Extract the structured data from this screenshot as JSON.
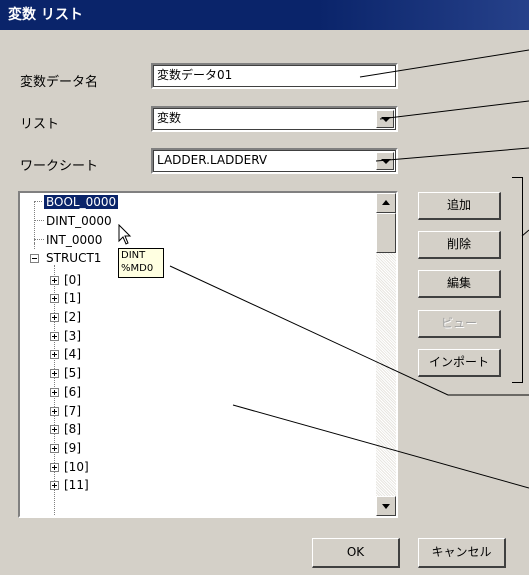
{
  "dialog": {
    "title": "変数 リスト",
    "variable_name": {
      "label": "変数データ名",
      "value": "変数データ01"
    },
    "list": {
      "label": "リスト",
      "value": "変数"
    },
    "worksheet": {
      "label": "ワークシート",
      "value": "LADDER.LADDERV"
    },
    "tree": {
      "items": [
        {
          "text": "BOOL_0000",
          "selected": true
        },
        {
          "text": "DINT_0000"
        },
        {
          "text": "INT_0000"
        },
        {
          "text": "STRUCT1",
          "expanded": true
        },
        {
          "text": "[0]"
        },
        {
          "text": "[1]"
        },
        {
          "text": "[2]"
        },
        {
          "text": "[3]"
        },
        {
          "text": "[4]"
        },
        {
          "text": "[5]"
        },
        {
          "text": "[6]"
        },
        {
          "text": "[7]"
        },
        {
          "text": "[8]"
        },
        {
          "text": "[9]"
        },
        {
          "text": "[10]"
        },
        {
          "text": "[11]"
        }
      ],
      "tooltip": {
        "line1": "DINT",
        "line2": "%MD0"
      }
    },
    "buttons": {
      "add": "追加",
      "delete": "削除",
      "edit": "編集",
      "view": "ビュー",
      "import": "インポート",
      "ok": "OK",
      "cancel": "キャンセル"
    }
  }
}
